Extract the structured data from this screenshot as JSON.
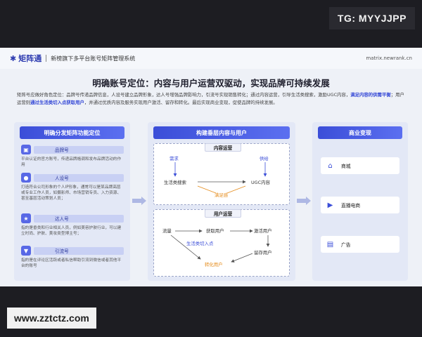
{
  "watermarks": {
    "top": "TG: MYYJJPP",
    "bottom": "www.zztctz.com"
  },
  "header": {
    "logo": "矩阵通",
    "subtitle": "新榜旗下多平台账号矩阵管理系统",
    "url": "matrix.newrank.cn"
  },
  "title": "明确账号定位：内容与用户运营双驱动，实现品牌可持续发展",
  "description": {
    "p1": "矩阵号应做好角色定位：品牌号传递品牌信息，人设号建立品牌形象，达人号增强品牌影响力，引流号实现销售转化；通过内容运营，引导生活类搜索，激励UGC内容，",
    "p2_hl1": "满足内容的供需平衡",
    "p2_mid": "；用户运营则",
    "p2_hl2": "通过生活类切入点获取用户",
    "p2_end": "，并通过优质内容及服务实现用户激活、留存和转化。最后实现商业变现，促使品牌的持续发展。"
  },
  "left_panel": {
    "title": "明确分发矩阵功能定位",
    "roles": [
      {
        "icon": "badge-icon",
        "name": "品牌号",
        "desc": "平台认证的官方账号，传递品牌格调和发布品牌活动的作用"
      },
      {
        "icon": "person-icon",
        "name": "人设号",
        "desc": "打造符合公司形象的个人IP形象，通常可以是某品牌高层或专业工作人员，如摄影师、市场营销专员、入力资源、甚至基层活动策划人员；"
      },
      {
        "icon": "star-user-icon",
        "name": "达人号",
        "desc": "指的是垂类和行业相关人员，例如美容护肤行业，可以建立时尚、护肤、美妆类型博主号；"
      },
      {
        "icon": "funnel-icon",
        "name": "引流号",
        "desc": "指的是在评论区活跃或者私信帮助引流到微信或者其他平台的账号"
      }
    ]
  },
  "middle_panel": {
    "title": "构建垂层内容与用户",
    "content_ops": {
      "title": "内容运营",
      "demand": "需求",
      "supply": "供给",
      "life_search": "生活类搜索",
      "ugc": "UGC内容",
      "satisfy": "满足感"
    },
    "user_ops": {
      "title": "用户运营",
      "traffic": "流量",
      "acquire": "获取用户",
      "activate": "激活用户",
      "life_entry": "生活类切入点",
      "retain": "留存用户",
      "convert": "转化用户"
    }
  },
  "right_panel": {
    "title": "商业变现",
    "items": [
      {
        "icon": "store-icon",
        "label": "商城"
      },
      {
        "icon": "live-commerce-icon",
        "label": "直播电商"
      },
      {
        "icon": "ad-icon",
        "label": "广告"
      }
    ]
  },
  "colors": {
    "accent": "#3b4ed8",
    "orange": "#e58b1a",
    "panel": "#e3e8f6"
  }
}
